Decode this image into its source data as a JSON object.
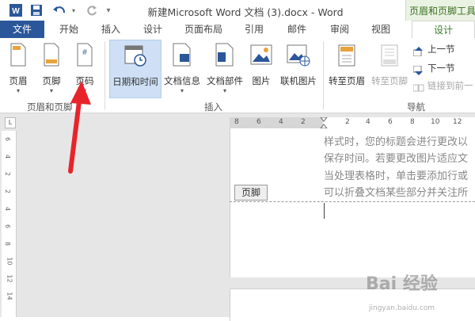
{
  "window": {
    "title": "新建Microsoft Word 文档 (3).docx - Word",
    "context_group": "页眉和页脚工具",
    "controls": {
      "help": "?",
      "restore": "▣",
      "minimize": "—"
    }
  },
  "tabs": {
    "file": "文件",
    "home": "开始",
    "insert": "插入",
    "design_layout": "设计",
    "page_layout": "页面布局",
    "references": "引用",
    "mailings": "邮件",
    "review": "审阅",
    "view": "视图",
    "context_design": "设计"
  },
  "ribbon": {
    "header_footer_group": {
      "label": "页眉和页脚",
      "header": "页眉",
      "footer": "页脚",
      "page_number": "页码"
    },
    "insert_group": {
      "label": "插入",
      "date_time": "日期和时间",
      "doc_info": "文档信息",
      "doc_parts": "文档部件",
      "picture": "图片",
      "online_picture": "联机图片"
    },
    "nav_group": {
      "label": "导航",
      "goto_header": "转至页眉",
      "goto_footer": "转至页脚",
      "prev_section": "上一节",
      "next_section": "下一节",
      "link_previous": "链接到前一"
    }
  },
  "ruler": {
    "left_ticks": [
      "8",
      "6",
      "4",
      "2"
    ],
    "right_ticks": [
      "2",
      "4",
      "6",
      "8",
      "10",
      "12"
    ],
    "vertical_marks": [
      "6",
      "4",
      "2",
      "2",
      "4",
      "6",
      "8",
      "10",
      "12",
      "14"
    ],
    "corner_symbol": "L"
  },
  "document": {
    "lines": [
      "样式时，您的标题会进行更改以",
      "保存时间。若要更改图片适应文",
      "当处理表格时，单击要添加行或",
      "可以折叠文档某些部分并关注所"
    ],
    "footer_tag": "页脚"
  },
  "watermark": {
    "text": "Bai 经验",
    "url": "jingyan.baidu.com"
  },
  "colors": {
    "file_tab": "#2b579a",
    "context_accent": "#3b7b2a",
    "arrow": "#e8242b",
    "active_button": "#cfe0f6"
  }
}
